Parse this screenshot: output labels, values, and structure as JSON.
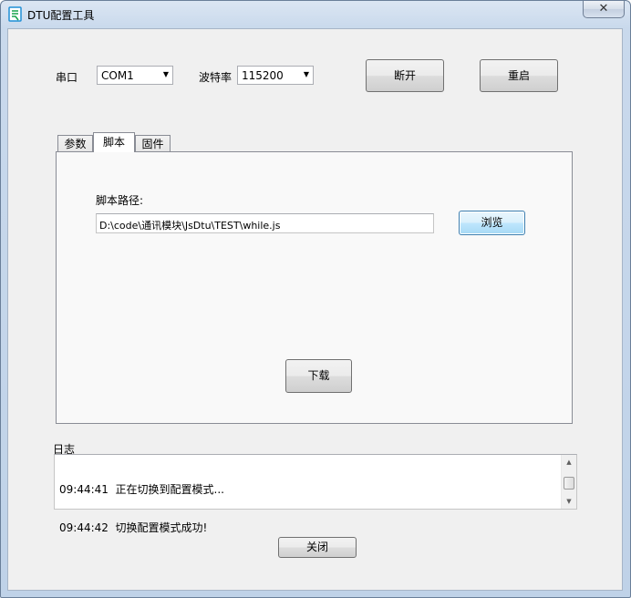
{
  "window": {
    "title": "DTU配置工具",
    "close_glyph": "✕",
    "icon": "app-logo-icon"
  },
  "connection": {
    "port_label": "串口",
    "port_value": "COM1",
    "baud_label": "波特率",
    "baud_value": "115200",
    "disconnect_label": "断开",
    "restart_label": "重启"
  },
  "tabs": [
    {
      "label": "参数",
      "active": false
    },
    {
      "label": "脚本",
      "active": true
    },
    {
      "label": "固件",
      "active": false
    }
  ],
  "script_panel": {
    "path_label": "脚本路径:",
    "path_value": "D:\\code\\通讯模块\\JsDtu\\TEST\\while.js",
    "browse_label": "浏览",
    "download_label": "下载"
  },
  "log": {
    "label": "日志",
    "lines": [
      "09:44:41  正在切换到配置模式...",
      "09:44:42  切换配置模式成功!"
    ]
  },
  "footer": {
    "close_label": "关闭"
  }
}
